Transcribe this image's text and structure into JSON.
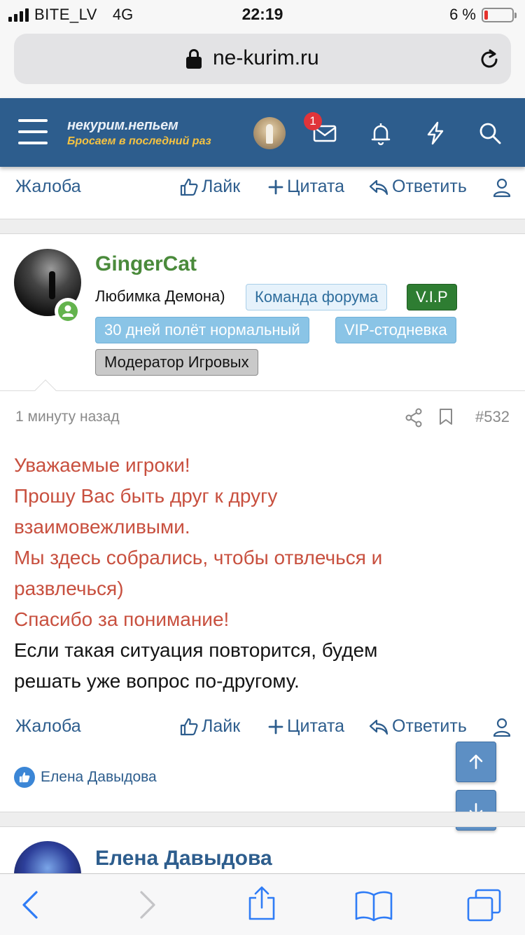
{
  "status_bar": {
    "carrier": "BITE_LV",
    "network": "4G",
    "time": "22:19",
    "battery_text": "6 %",
    "battery_level": 0.06
  },
  "browser": {
    "url": "ne-kurim.ru"
  },
  "site_header": {
    "logo_main": "некурим.непьем",
    "logo_sub": "Бросаем в последний раз",
    "notification_count": "1"
  },
  "actions": {
    "report": "Жалоба",
    "like": "Лайк",
    "quote": "Цитата",
    "reply": "Ответить"
  },
  "post": {
    "username": "GingerCat",
    "user_title": "Любимка Демона)",
    "banners": [
      "Команда форума",
      "V.I.P",
      "30 дней полёт нормальный",
      "VIP-стодневка",
      "Модератор Игровых"
    ],
    "time": "1 минуту назад",
    "number": "#532",
    "body_red": [
      "Уважаемые игроки!",
      "Прошу Вас быть друг к другу",
      "взаимовежливыми.",
      "Мы здесь собрались, чтобы отвлечься и",
      "развлечься)",
      "Спасибо за понимание!"
    ],
    "body_black": [
      "Если такая ситуация повторится, будем",
      "решать уже вопрос по-другому."
    ],
    "liked_by": "Елена Давыдова"
  },
  "next_post": {
    "username": "Елена Давыдова"
  },
  "colors": {
    "header_bg": "#2d5d8d",
    "link": "#2d5d8d",
    "username_green": "#4a8a3b",
    "body_red": "#c8503f",
    "ios_blue": "#2f7cf6"
  }
}
